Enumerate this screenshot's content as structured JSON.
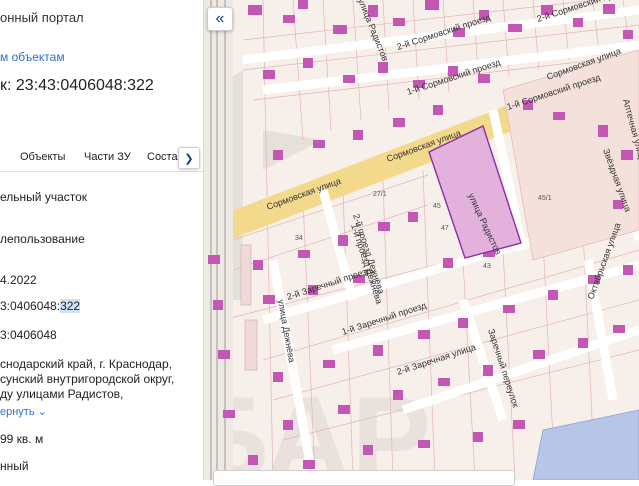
{
  "panel": {
    "portal_title": "онный портал",
    "objects_link": "м объектам",
    "cadastral_label": "к: 23:43:0406048:322",
    "tabs": [
      "Объекты",
      "Части ЗУ",
      "Состав"
    ],
    "fields": {
      "type": "ельный участок",
      "status": "лепользование",
      "date": "4.2022",
      "number_prefix": "3:0406048:",
      "number_suffix": "322",
      "quarter": "3:0406048",
      "address_lines": [
        "снодарский край, г. Краснодар,",
        "сунский внутригородской округ,",
        "ду улицами Радистов,"
      ],
      "collapse_label": "ернуть",
      "area": "99 кв. м",
      "category": "нный"
    }
  },
  "map": {
    "street_labels": [
      "Сормовская улица",
      "Сормовская улица",
      "Сормовская улица",
      "2-й Сормовский проезд",
      "1-й Сормовский проезд",
      "2-й Сормовский проезд",
      "1-й Сормовский проезд",
      "улица Радистов",
      "улица Радистов",
      "2-й проезд Дежнёва",
      "1-й проезд Дежнёва",
      "2-й Заречный проезд",
      "1-й Заречный проезд",
      "2-й Заречная улица",
      "улица Дежнёва",
      "Заречный переулок",
      "Октябрьская улица",
      "Звёздная улица",
      "Аптечная улица",
      "Радистов",
      "улица"
    ],
    "house_numbers": [
      "34",
      "45/1",
      "43",
      "45",
      "47",
      "27/1"
    ],
    "colors": {
      "background": "#f7efe9",
      "main_road": "#f3d98b",
      "parcel_fill": "#e8c6e0",
      "parcel_stroke": "#8c2da6",
      "building": "#c557b4",
      "water": "#b7c6e8",
      "railway": "#9a9a9a"
    },
    "watermark": "БАР"
  },
  "ui": {
    "collapse_icon": "chevron-double-left-icon",
    "tab_next_icon": "chevron-right-icon"
  }
}
